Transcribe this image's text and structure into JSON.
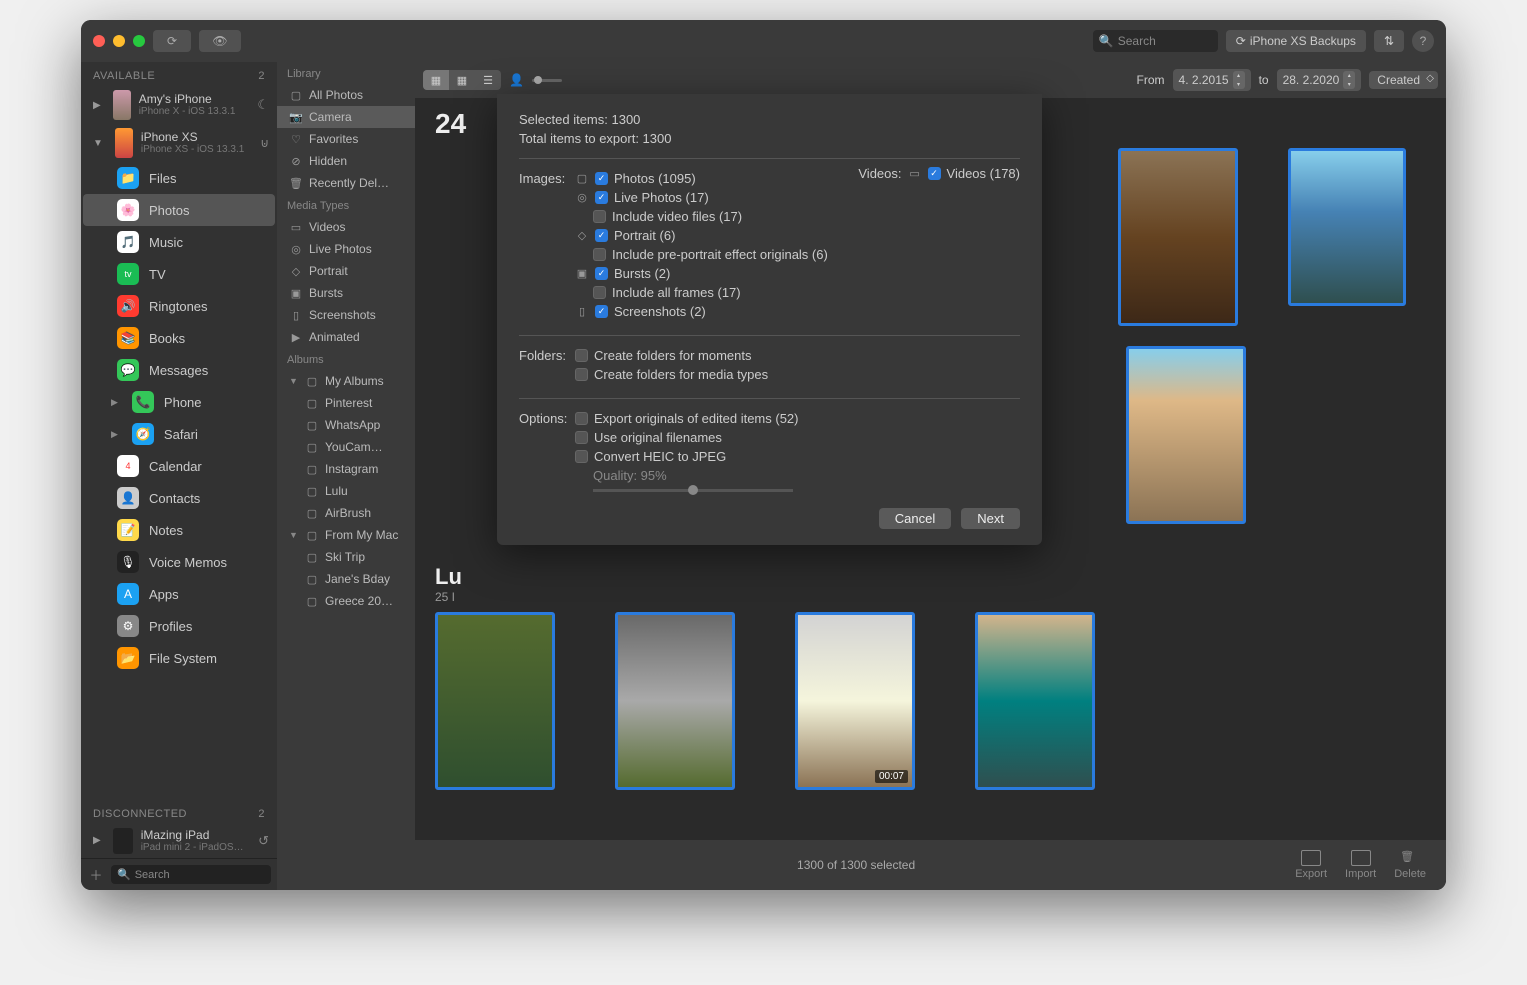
{
  "titlebar": {
    "search_placeholder": "Search",
    "backups_label": "iPhone XS Backups",
    "unknown_btn": "⇅"
  },
  "sidebar_left": {
    "available_hdr": "AVAILABLE",
    "available_count": "2",
    "devices": [
      {
        "name": "Amy's iPhone",
        "sub": "iPhone X - iOS 13.3.1"
      },
      {
        "name": "iPhone XS",
        "sub": "iPhone XS - iOS 13.3.1"
      }
    ],
    "apps": [
      {
        "label": "Files",
        "color": "#1ba1f2"
      },
      {
        "label": "Photos",
        "color": "#ffffff",
        "selected": true
      },
      {
        "label": "Music",
        "color": "#fa3c55"
      },
      {
        "label": "TV",
        "color": "#1abc54"
      },
      {
        "label": "Ringtones",
        "color": "#ff3b30"
      },
      {
        "label": "Books",
        "color": "#ff9500"
      },
      {
        "label": "Messages",
        "color": "#34c759"
      },
      {
        "label": "Phone",
        "color": "#34c759",
        "disc": true
      },
      {
        "label": "Safari",
        "color": "#1ba1f2",
        "disc": true
      },
      {
        "label": "Calendar",
        "color": "#ffffff"
      },
      {
        "label": "Contacts",
        "color": "#a8a8a8"
      },
      {
        "label": "Notes",
        "color": "#ffd94a"
      },
      {
        "label": "Voice Memos",
        "color": "#222"
      },
      {
        "label": "Apps",
        "color": "#1ba1f2"
      },
      {
        "label": "Profiles",
        "color": "#888"
      },
      {
        "label": "File System",
        "color": "#ff9500"
      }
    ],
    "disconnected_hdr": "DISCONNECTED",
    "disconnected_count": "2",
    "disc_device": {
      "name": "iMazing iPad",
      "sub": "iPad mini 2 - iPadOS…"
    },
    "footer_search": "Search"
  },
  "sidebar_mid": {
    "sections": {
      "library": {
        "hdr": "Library",
        "items": [
          "All Photos",
          "Camera",
          "Favorites",
          "Hidden",
          "Recently Del…"
        ],
        "selected": "Camera"
      },
      "media": {
        "hdr": "Media Types",
        "items": [
          "Videos",
          "Live Photos",
          "Portrait",
          "Bursts",
          "Screenshots",
          "Animated"
        ]
      },
      "albums": {
        "hdr": "Albums",
        "my_albums": {
          "label": "My Albums",
          "items": [
            "Pinterest",
            "WhatsApp",
            "YouCam…",
            "Instagram",
            "Lulu",
            "AirBrush"
          ]
        },
        "from_mac": {
          "label": "From My Mac",
          "items": [
            "Ski Trip",
            "Jane's Bday",
            "Greece 20…"
          ]
        }
      }
    }
  },
  "main": {
    "count_hdr": "24",
    "from_label": "From",
    "date_from": "4.  2.2015",
    "to_label": "to",
    "date_to": "28.  2.2020",
    "sort_label": "Created",
    "section2_title": "Lu",
    "section2_sub": "25 I",
    "video_time": "00:07"
  },
  "dialog": {
    "selected_items": "Selected items: 1300",
    "total_items": "Total items to export: 1300",
    "images_label": "Images:",
    "videos_label": "Videos:",
    "videos_cb": "Videos (178)",
    "img_rows": {
      "photos": "Photos (1095)",
      "live": "Live Photos (17)",
      "live_sub": "Include video files (17)",
      "portrait": "Portrait (6)",
      "portrait_sub": "Include pre-portrait effect originals (6)",
      "bursts": "Bursts (2)",
      "bursts_sub": "Include all frames (17)",
      "screenshots": "Screenshots (2)"
    },
    "folders_label": "Folders:",
    "folders": {
      "moments": "Create folders for moments",
      "types": "Create folders for media types"
    },
    "options_label": "Options:",
    "options": {
      "originals": "Export originals of edited items (52)",
      "filenames": "Use original filenames",
      "heic": "Convert HEIC to JPEG",
      "quality": "Quality: 95%"
    },
    "cancel": "Cancel",
    "next": "Next"
  },
  "footer": {
    "status": "1300 of 1300 selected",
    "export": "Export",
    "import": "Import",
    "delete": "Delete"
  }
}
